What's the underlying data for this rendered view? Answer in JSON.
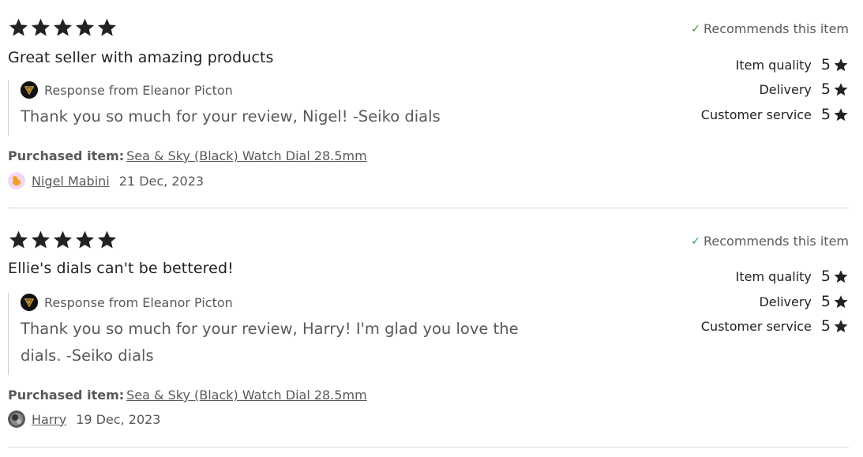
{
  "reviews": [
    {
      "rating": 5,
      "title": "Great seller with amazing products",
      "response_label": "Response from Eleanor Picton",
      "response_text": "Thank you so much for your review, Nigel! -Seiko dials",
      "purchased_label": "Purchased item:",
      "purchased_item": "Sea & Sky (Black) Watch Dial 28.5mm",
      "reviewer_name": "Nigel Mabini",
      "date": "21 Dec, 2023",
      "recommends": "Recommends this item",
      "subratings": [
        {
          "label": "Item quality",
          "value": "5"
        },
        {
          "label": "Delivery",
          "value": "5"
        },
        {
          "label": "Customer service",
          "value": "5"
        }
      ]
    },
    {
      "rating": 5,
      "title": "Ellie's dials can't be bettered!",
      "response_label": "Response from Eleanor Picton",
      "response_text": "Thank you so much for your review, Harry! I'm glad you love the dials. -Seiko dials",
      "purchased_label": "Purchased item:",
      "purchased_item": "Sea & Sky (Black) Watch Dial 28.5mm",
      "reviewer_name": "Harry",
      "date": "19 Dec, 2023",
      "recommends": "Recommends this item",
      "subratings": [
        {
          "label": "Item quality",
          "value": "5"
        },
        {
          "label": "Delivery",
          "value": "5"
        },
        {
          "label": "Customer service",
          "value": "5"
        }
      ]
    }
  ],
  "colors": {
    "star": "#222222",
    "check": "#2e9e46",
    "text_muted": "#595959",
    "divider": "#d8d8d8"
  },
  "icons": {
    "star": "star-icon",
    "check": "check-icon",
    "shop_avatar": "shop-logo-avatar",
    "reviewer_avatar": "user-avatar"
  }
}
